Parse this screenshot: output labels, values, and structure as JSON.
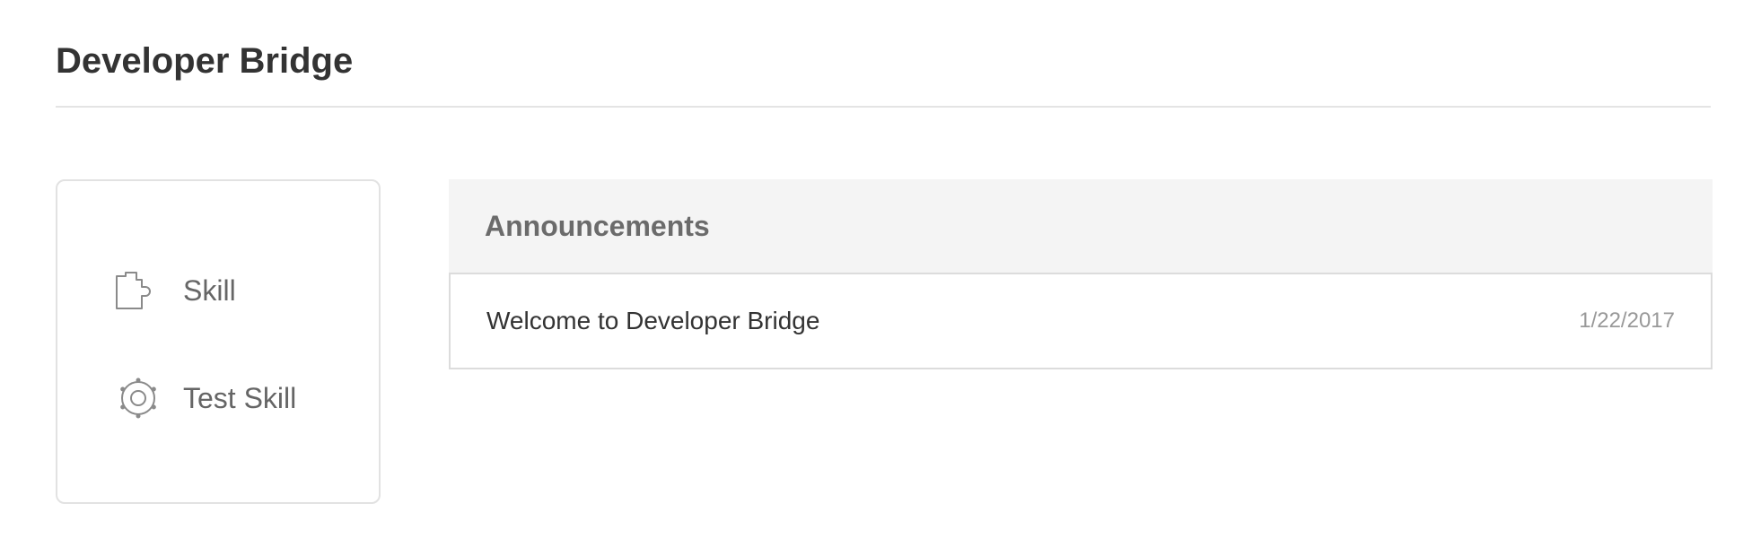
{
  "header": {
    "title": "Developer Bridge"
  },
  "sidebar": {
    "items": [
      {
        "label": "Skill",
        "icon": "puzzle-piece-icon"
      },
      {
        "label": "Test Skill",
        "icon": "gear-icon"
      }
    ]
  },
  "announcements": {
    "title": "Announcements",
    "items": [
      {
        "text": "Welcome to Developer Bridge",
        "date": "1/22/2017"
      }
    ]
  },
  "colors": {
    "title_text": "#333333",
    "muted_text": "#666666",
    "header_bg": "#f4f4f4",
    "border": "#e2e2e2",
    "date_text": "#999999"
  }
}
